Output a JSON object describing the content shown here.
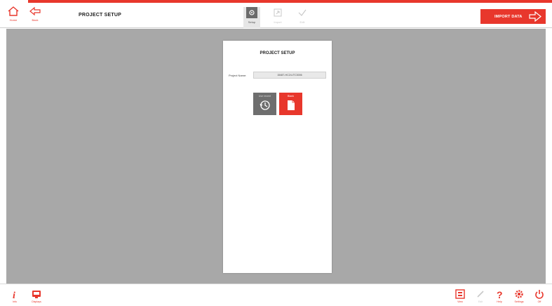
{
  "topbar": {
    "home_label": "Home",
    "back_label": "Back",
    "page_title": "PROJECT SETUP",
    "steps": [
      {
        "label": "Setup",
        "active": true
      },
      {
        "label": "Import",
        "active": false
      },
      {
        "label": "Edit",
        "active": false
      }
    ],
    "import_label": "IMPORT DATA"
  },
  "panel": {
    "title": "PROJECT SETUP",
    "project_name_label": "Project Name:",
    "project_name_value": "15487-HC24-ITC3006",
    "tiles": {
      "recent_label": "Use recent",
      "blank_label": "Blank"
    }
  },
  "bottombar": {
    "info_label": "Info",
    "display_label": "Displays",
    "view_label": "View",
    "edit_label": "Edit",
    "help_label": "Help",
    "settings_label": "Settings",
    "exit_label": "Off"
  },
  "colors": {
    "accent": "#e8372c",
    "workspace": "#a8a8a8",
    "tile_gray": "#6e6e6e"
  }
}
